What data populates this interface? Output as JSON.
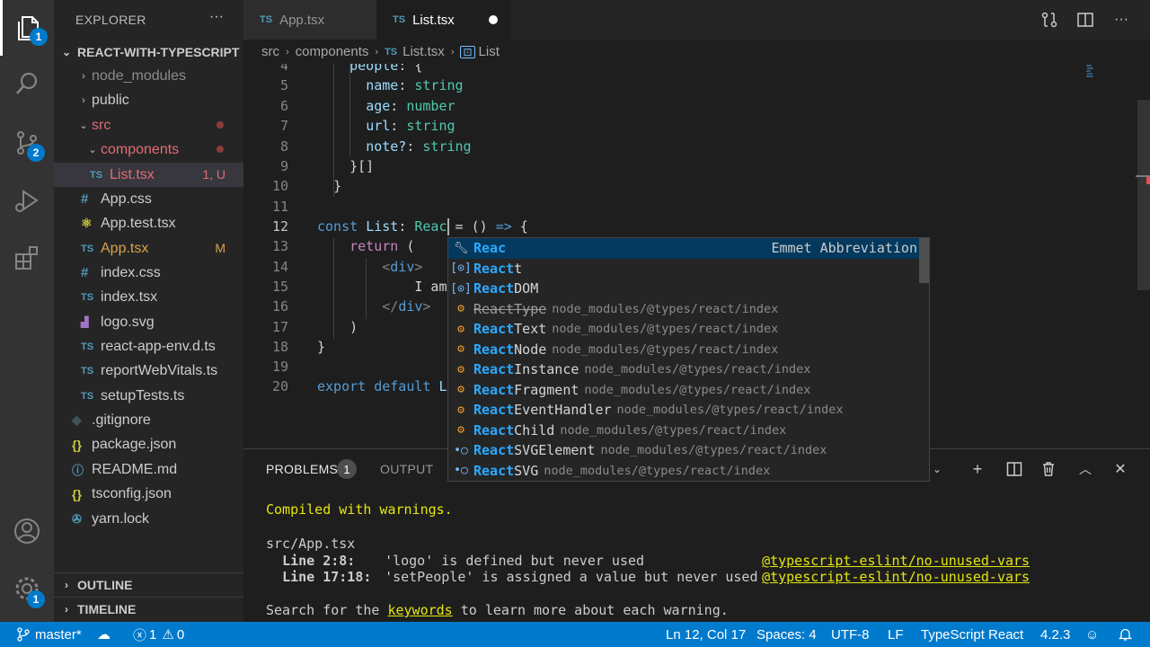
{
  "activity_bar": {
    "explorer_badge": "1",
    "scm_badge": "2",
    "settings_badge": "1"
  },
  "sidebar": {
    "title": "EXPLORER",
    "more": "···",
    "project": "REACT-WITH-TYPESCRIPT",
    "items": [
      {
        "label": "node_modules",
        "type": "folder"
      },
      {
        "label": "public",
        "type": "folder"
      },
      {
        "label": "src",
        "type": "folder"
      },
      {
        "label": "components",
        "type": "folder"
      },
      {
        "label": "List.tsx",
        "type": "file",
        "decoration": "1, U"
      },
      {
        "label": "App.css",
        "type": "file"
      },
      {
        "label": "App.test.tsx",
        "type": "file"
      },
      {
        "label": "App.tsx",
        "type": "file",
        "decoration": "M"
      },
      {
        "label": "index.css",
        "type": "file"
      },
      {
        "label": "index.tsx",
        "type": "file"
      },
      {
        "label": "logo.svg",
        "type": "file"
      },
      {
        "label": "react-app-env.d.ts",
        "type": "file"
      },
      {
        "label": "reportWebVitals.ts",
        "type": "file"
      },
      {
        "label": "setupTests.ts",
        "type": "file"
      },
      {
        "label": ".gitignore",
        "type": "file"
      },
      {
        "label": "package.json",
        "type": "file"
      },
      {
        "label": "README.md",
        "type": "file"
      },
      {
        "label": "tsconfig.json",
        "type": "file"
      },
      {
        "label": "yarn.lock",
        "type": "file"
      }
    ],
    "outline": "OUTLINE",
    "timeline": "TIMELINE"
  },
  "tabs": [
    {
      "label": "App.tsx",
      "prefix": "TS"
    },
    {
      "label": "List.tsx",
      "prefix": "TS"
    }
  ],
  "breadcrumb": {
    "parts": [
      "src",
      "components",
      "List.tsx",
      "List"
    ],
    "ts_prefix": "TS"
  },
  "editor": {
    "line_numbers": [
      "4",
      "5",
      "6",
      "7",
      "8",
      "9",
      "10",
      "11",
      "12",
      "13",
      "14",
      "15",
      "16",
      "17",
      "18",
      "19",
      "20"
    ],
    "lines": {
      "l4_key": "people",
      "l4_rest": ": {",
      "l5_key": "name",
      "l5_type": "string",
      "l6_key": "age",
      "l6_type": "number",
      "l7_key": "url",
      "l7_type": "string",
      "l8_key": "note?",
      "l8_type": "string",
      "l9": "}[]",
      "l10": "}",
      "l12_kw": "const",
      "l12_name": "List",
      "l12_type": "Reac",
      "l12_eq": " = () ",
      "l12_arrow": "=>",
      "l12_brace": " {",
      "l13_kw": "return",
      "l13_rest": " (",
      "l14_open": "<",
      "l14_tag": "div",
      "l14_close": ">",
      "l15": "I am",
      "l16_open": "</",
      "l16_tag": "div",
      "l16_close": ">",
      "l17": ")",
      "l18": "}",
      "l20_kw1": "export",
      "l20_kw2": "default",
      "l20_rest": "L"
    }
  },
  "suggest": {
    "items": [
      {
        "match": "Reac",
        "rest": "",
        "icon": "wrench-icon",
        "detail": "",
        "right": "Emmet Abbreviation"
      },
      {
        "match": "React",
        "rest": "t",
        "icon": "module-icon",
        "detail": ""
      },
      {
        "match": "React",
        "rest": "DOM",
        "icon": "module-icon",
        "detail": ""
      },
      {
        "match": "React",
        "rest": "Type",
        "icon": "variable-icon",
        "detail": "node_modules/@types/react/index"
      },
      {
        "match": "React",
        "rest": "Text",
        "icon": "variable-icon",
        "detail": "node_modules/@types/react/index"
      },
      {
        "match": "React",
        "rest": "Node",
        "icon": "variable-icon",
        "detail": "node_modules/@types/react/index"
      },
      {
        "match": "React",
        "rest": "Instance",
        "icon": "variable-icon",
        "detail": "node_modules/@types/react/index"
      },
      {
        "match": "React",
        "rest": "Fragment",
        "icon": "variable-icon",
        "detail": "node_modules/@types/react/index"
      },
      {
        "match": "React",
        "rest": "EventHandler",
        "icon": "variable-icon",
        "detail": "node_modules/@types/react/index"
      },
      {
        "match": "React",
        "rest": "Child",
        "icon": "variable-icon",
        "detail": "node_modules/@types/react/index"
      },
      {
        "match": "React",
        "rest": "SVGElement",
        "icon": "interface-icon",
        "detail": "node_modules/@types/react/index"
      },
      {
        "match": "React",
        "rest": "SVG",
        "icon": "interface-icon",
        "detail": "node_modules/@types/react/index"
      }
    ]
  },
  "panel": {
    "problems_label": "PROBLEMS",
    "problems_count": "1",
    "output_label": "OUTPUT",
    "terminal": {
      "line1": "Compiled with warnings.",
      "line2": "src/App.tsx",
      "w1_loc": "Line 2:8:",
      "w1_msg": "'logo' is defined but never used",
      "w1_rule": "@typescript-eslint/no-unused-vars",
      "w2_loc": "Line 17:18:",
      "w2_msg": "'setPeople' is assigned a value but never used",
      "w2_rule": "@typescript-eslint/no-unused-vars",
      "l5_pre": "Search for the ",
      "l5_link": "keywords",
      "l5_post": " to learn more about each warning."
    }
  },
  "status_bar": {
    "branch": "master*",
    "errors": "1",
    "warnings": "0",
    "position": "Ln 12, Col 17",
    "spaces": "Spaces: 4",
    "encoding": "UTF-8",
    "eol": "LF",
    "language": "TypeScript React",
    "version": "4.2.3"
  }
}
